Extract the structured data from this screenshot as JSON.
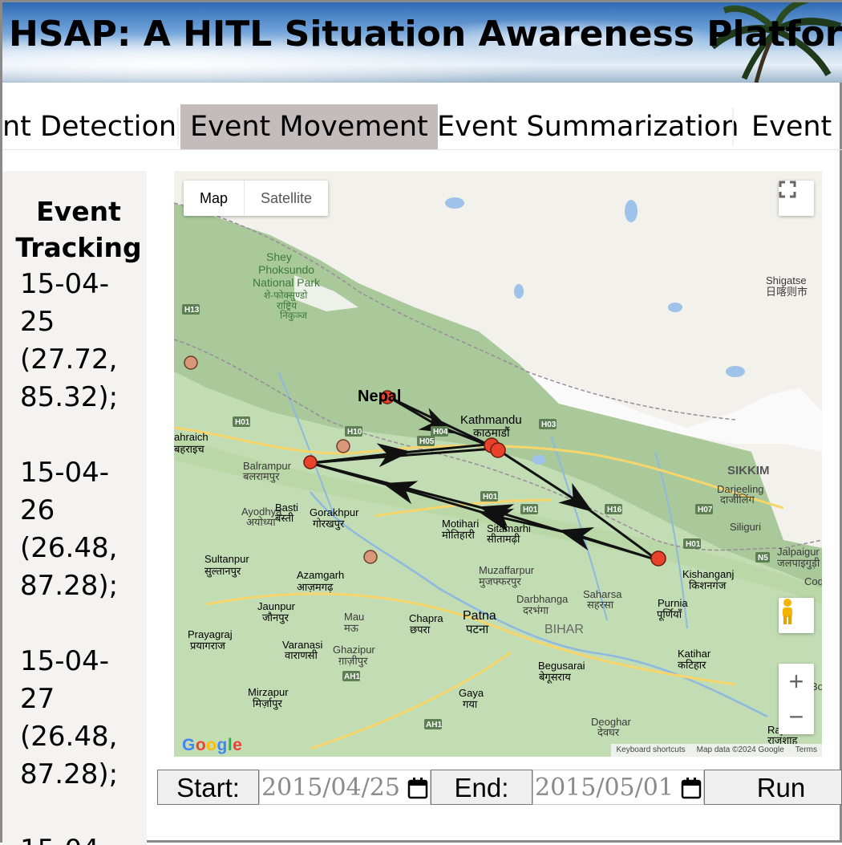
{
  "header": {
    "title": "HSAP: A HITL Situation Awareness Platform"
  },
  "tabs": [
    {
      "label": "nt Detection",
      "active": false
    },
    {
      "label": "Event Movement",
      "active": true
    },
    {
      "label": "Event Summarization",
      "active": false
    },
    {
      "label": "Event E",
      "active": false
    }
  ],
  "sidebar": {
    "heading": "Event Tracking",
    "entries": [
      "15-04-25 (27.72, 85.32);",
      "15-04-26 (26.48, 87.28);",
      "15-04-27 (26.48, 87.28);",
      "15-04-"
    ]
  },
  "map": {
    "type_map": "Map",
    "type_satellite": "Satellite",
    "zoom_in": "+",
    "zoom_out": "−",
    "logo": "Google",
    "attribution": [
      "Keyboard shortcuts",
      "Map data ©2024 Google",
      "Terms"
    ],
    "labels": {
      "shey": "Shey",
      "phoksundo": "Phoksundo",
      "national_park": "National Park",
      "shey_dev": "शे-फोक्सुण्डो",
      "shey_dev2": "राष्ट्रिय",
      "shey_dev3": "निकुञ्ज",
      "shigatse": "Shigatse",
      "shigatse_cn": "日喀则市",
      "nepal": "Nepal",
      "kathmandu": "Kathmandu",
      "kathmandu_dev": "काठमाडौं",
      "bahraich": "ahraich",
      "bahraich_dev": "बहराइच",
      "balrampur": "Balrampur",
      "balrampur_dev": "बलरामपुर",
      "sikkim": "SIKKIM",
      "darjeeling": "Darjeeling",
      "darjeeling_dev": "दार्जीलिंग",
      "siliguri": "Siliguri",
      "ayodhya": "Ayodhya",
      "ayodhya_dev": "अयोध्या",
      "basti": "Basti",
      "basti_dev": "बस्ती",
      "gorakhpur": "Gorakhpur",
      "gorakhpur_dev": "गोरखपुर",
      "motihari": "Motihari",
      "motihari_dev": "मोतिहारी",
      "sitamarhi": "Sitamarhi",
      "sitamarhi_dev": "सीतामढ़ी",
      "jalpaiguri": "Jalpaigur",
      "jalpaiguri_dev": "जलपाइगुड़ी",
      "sultanpur": "Sultanpur",
      "sultanpur_dev": "सुल्तानपुर",
      "azamgarh": "Azamgarh",
      "azamgarh_dev": "आज़मगढ़",
      "muzaffarpur": "Muzaffarpur",
      "muzaffarpur_dev": "मुजफ्फरपुर",
      "saharsa": "Saharsa",
      "saharsa_dev": "सहरसा",
      "kishanganj": "Kishanganj",
      "kishanganj_dev": "किशनगंज",
      "darbhanga": "Darbhanga",
      "darbhanga_dev": "दरभंगा",
      "jaunpur": "Jaunpur",
      "jaunpur_dev": "जौनपुर",
      "mau": "Mau",
      "mau_dev": "मऊ",
      "chapra": "Chapra",
      "chapra_dev": "छपरा",
      "patna": "Patna",
      "patna_dev": "पटना",
      "bihar": "BIHAR",
      "purnia": "Purnia",
      "purnia_dev": "पूर्णियाँ",
      "prayagraj": "Prayagraj",
      "prayagraj_dev": "प्रयागराज",
      "varanasi": "Varanasi",
      "varanasi_dev": "वाराणसी",
      "ghazipur": "Ghazipur",
      "ghazipur_dev": "ग़ाज़ीपुर",
      "katihar": "Katihar",
      "katihar_dev": "कटिहार",
      "begusarai": "Begusarai",
      "begusarai_dev": "बेगूसराय",
      "mirzapur": "Mirzapur",
      "mirzapur_dev": "मिर्ज़ापुर",
      "gaya": "Gaya",
      "gaya_dev": "गया",
      "deoghar": "Deoghar",
      "deoghar_dev": "देवघर",
      "rajsha": "Rajsha",
      "rajsha_dev": "राजशाह",
      "cod": "Cod",
      "bo": "Bo"
    },
    "roads": [
      "H13",
      "H01",
      "H10",
      "H04",
      "H05",
      "H03",
      "H01",
      "H01",
      "H16",
      "H07",
      "H01",
      "N5",
      "AH1",
      "AH1",
      "13"
    ]
  },
  "controls": {
    "start_label": "Start:",
    "start_value": "2015/04/25",
    "end_label": "End:",
    "end_value": "2015/05/01",
    "run_label": "Run"
  },
  "colors": {
    "tab_active": "#c4bcbc",
    "marker_red": "#e8432a",
    "marker_tan": "#d9987a",
    "sidebar_bg": "#f4f3f2"
  }
}
